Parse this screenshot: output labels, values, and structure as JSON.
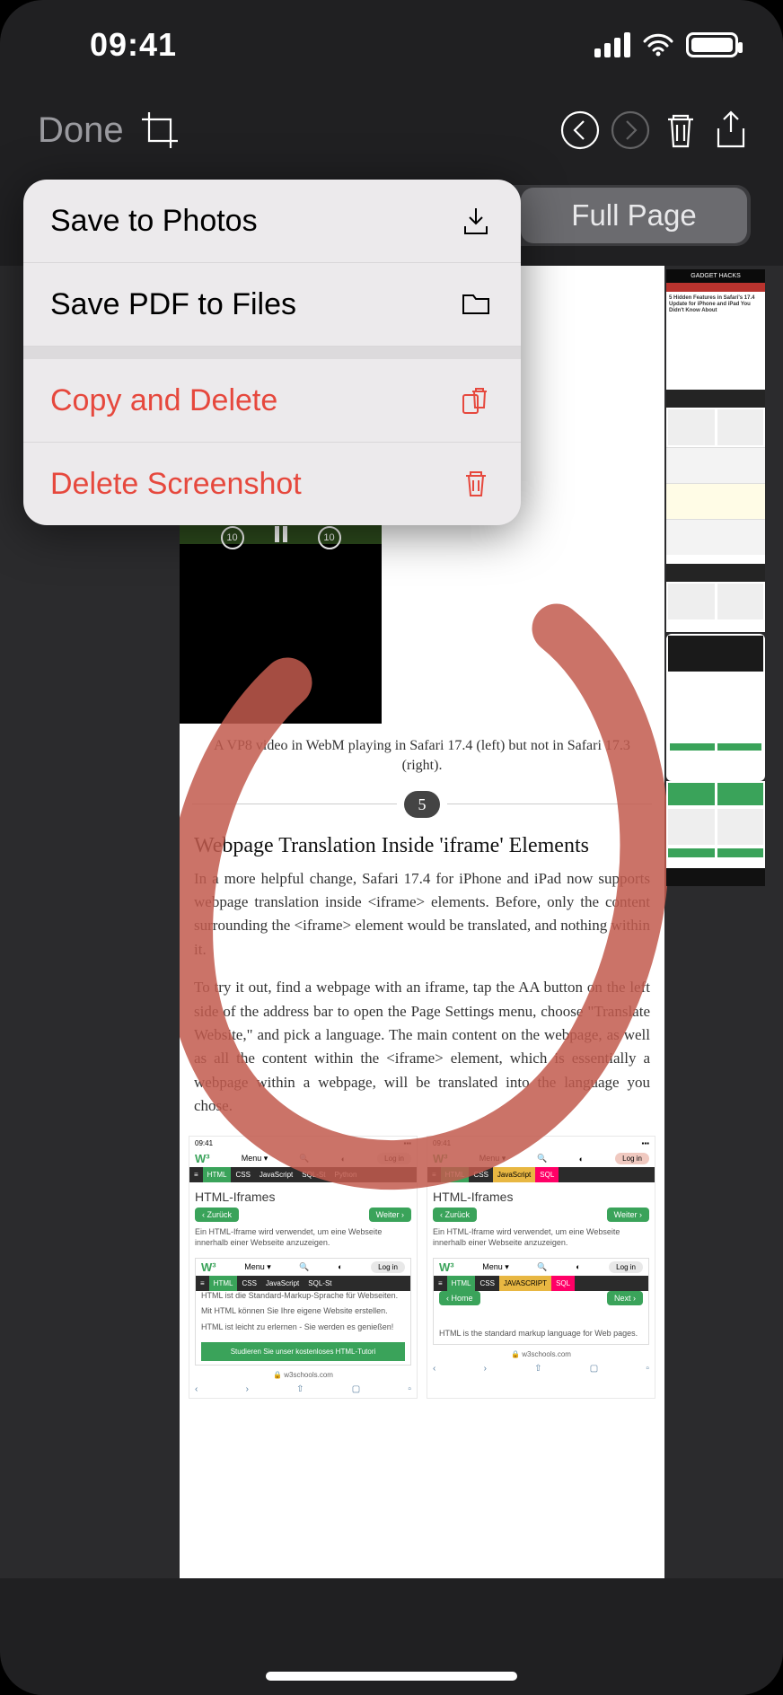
{
  "status": {
    "time": "09:41"
  },
  "toolbar": {
    "done": "Done"
  },
  "segmented": {
    "full_page": "Full Page"
  },
  "menu": {
    "save_photos": "Save to Photos",
    "save_pdf": "Save PDF to Files",
    "copy_delete": "Copy and Delete",
    "delete": "Delete Screenshot"
  },
  "page": {
    "caption": "A VP8 video in WebM playing in Safari 17.4 (left) but not in Safari 17.3 (right).",
    "section_number": "5",
    "heading": "Webpage Translation Inside 'iframe' Elements",
    "para1": "In a more helpful change, Safari 17.4 for iPhone and iPad now supports webpage translation inside <iframe> elements. Before, only the content surrounding the <iframe> element would be translated, and nothing within it.",
    "para2": "To try it out, find a webpage with an iframe, tap the AA button on the left side of the address bar to open the Page Settings menu, choose \"Translate Website,\" and pick a language. The main content on the webpage, as well as all the content within the <iframe> element, which is essentially a webpage within a webpage, will be translated into the language you chose.",
    "left_shot": {
      "time": "09:41",
      "logo": "W³",
      "menu": "Menu ▾",
      "login": "Log in",
      "tab_html": "HTML",
      "tab_css": "CSS",
      "tab_js": "JavaScript",
      "tab_sql": "SQL-St",
      "tab_py": "Python",
      "title": "HTML-Iframes",
      "back": "‹ Zurück",
      "next": "Weiter ›",
      "txt1": "Ein HTML-Iframe wird verwendet, um eine Webseite innerhalb einer Webseite anzuzeigen.",
      "inner_txt1": "HTML ist die Standard-Markup-Sprache für Webseiten.",
      "inner_txt2": "Mit HTML können Sie Ihre eigene Website erstellen.",
      "inner_txt3": "HTML ist leicht zu erlernen - Sie werden es genießen!",
      "inner_btn": "Studieren Sie unser kostenloses HTML-Tutori",
      "url": "w3schools.com"
    },
    "right_shot": {
      "time": "09:41",
      "logo": "W³",
      "menu": "Menu ▾",
      "login": "Log in",
      "tab_html": "HTML",
      "tab_css": "CSS",
      "tab_js": "JavaScript",
      "tab_sql": "SQL",
      "title": "HTML-Iframes",
      "back": "‹ Zurück",
      "next": "Weiter ›",
      "txt1": "Ein HTML-Iframe wird verwendet, um eine Webseite innerhalb einer Webseite anzuzeigen.",
      "inner_home": "‹ Home",
      "inner_next": "Next ›",
      "inner_tab_js": "JAVASCRIPT",
      "inner_txt": "HTML is the standard markup language for Web pages.",
      "url": "w3schools.com"
    }
  },
  "thumb": {
    "brand": "GADGET HACKS",
    "title": "5 Hidden Features in Safari's 17.4 Update for iPhone and iPad You Didn't Know About"
  }
}
